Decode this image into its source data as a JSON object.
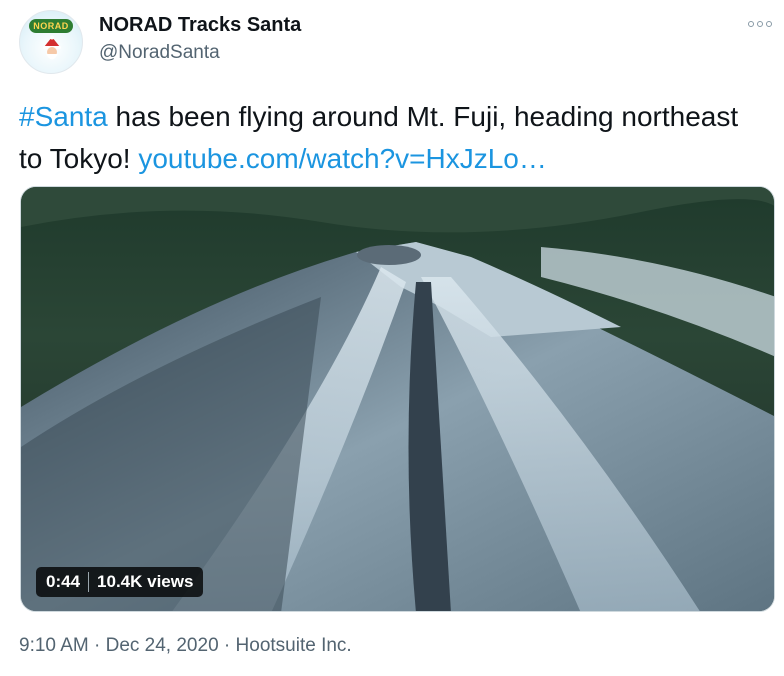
{
  "author": {
    "name": "NORAD Tracks Santa",
    "handle": "@NoradSanta",
    "avatar_badge_text": "NORAD"
  },
  "tweet": {
    "hashtag": "#Santa",
    "body": " has been flying around Mt. Fuji, heading northeast to Tokyo!  ",
    "link": "youtube.com/watch?v=HxJzLo…"
  },
  "video": {
    "duration": "0:44",
    "views": "10.4K views"
  },
  "meta": {
    "time": "9:10 AM",
    "separator": " · ",
    "date": "Dec 24, 2020",
    "source": "Hootsuite Inc."
  },
  "icons": {
    "more": "more-horizontal-icon"
  },
  "colors": {
    "link": "#1b95e0",
    "text": "#0f1419",
    "secondary": "#536471"
  }
}
